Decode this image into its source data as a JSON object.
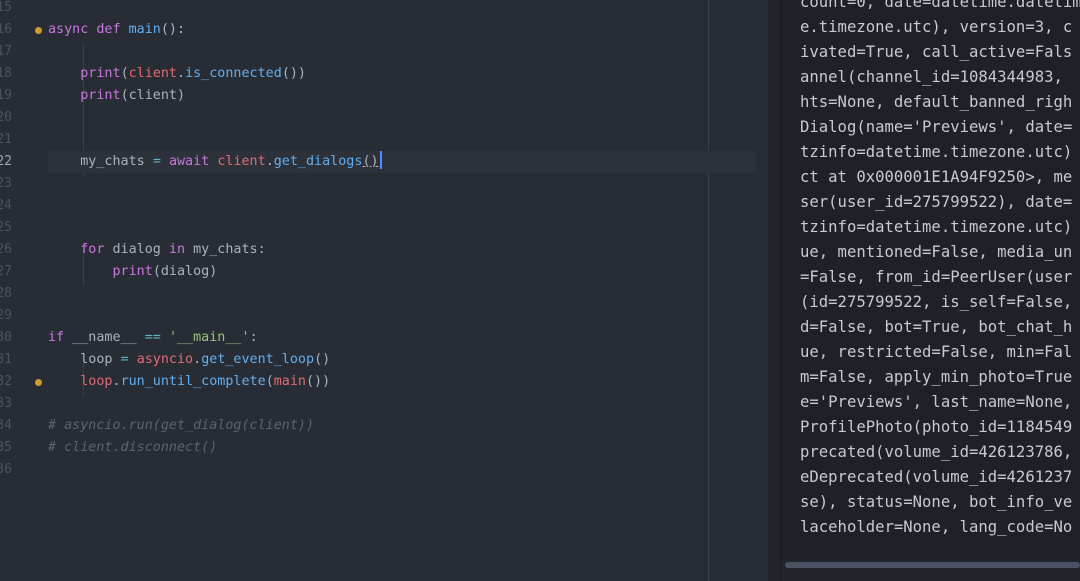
{
  "editor": {
    "lines": [
      {
        "num": "15",
        "tokens": []
      },
      {
        "num": "16",
        "breakpoint": true,
        "tokens": [
          {
            "t": "async def ",
            "c": "kw"
          },
          {
            "t": "main",
            "c": "fn"
          },
          {
            "t": "():",
            "c": "pa"
          }
        ]
      },
      {
        "num": "17",
        "tokens": []
      },
      {
        "num": "18",
        "tokens": [
          {
            "t": "    "
          },
          {
            "t": "print",
            "c": "kw"
          },
          {
            "t": "(",
            "c": "pa"
          },
          {
            "t": "client",
            "c": "vr"
          },
          {
            "t": ".",
            "c": "pa"
          },
          {
            "t": "is_connected",
            "c": "fn"
          },
          {
            "t": "())",
            "c": "pa"
          }
        ]
      },
      {
        "num": "19",
        "tokens": [
          {
            "t": "    "
          },
          {
            "t": "print",
            "c": "kw"
          },
          {
            "t": "(client)",
            "c": "pa"
          }
        ]
      },
      {
        "num": "20",
        "tokens": []
      },
      {
        "num": "21",
        "tokens": []
      },
      {
        "num": "22",
        "current": true,
        "tokens": [
          {
            "t": "    my_chats ",
            "c": "pa"
          },
          {
            "t": "=",
            "c": "op"
          },
          {
            "t": " "
          },
          {
            "t": "await",
            "c": "kw"
          },
          {
            "t": " "
          },
          {
            "t": "client",
            "c": "vr"
          },
          {
            "t": ".",
            "c": "pa"
          },
          {
            "t": "get_dialogs",
            "c": "fn"
          },
          {
            "t": "()",
            "c": "pa",
            "u": true
          }
        ]
      },
      {
        "num": "23",
        "tokens": []
      },
      {
        "num": "24",
        "tokens": []
      },
      {
        "num": "25",
        "tokens": []
      },
      {
        "num": "26",
        "tokens": [
          {
            "t": "    "
          },
          {
            "t": "for",
            "c": "kw"
          },
          {
            "t": " dialog ",
            "c": "pa"
          },
          {
            "t": "in",
            "c": "kw"
          },
          {
            "t": " my_chats:",
            "c": "pa"
          }
        ]
      },
      {
        "num": "27",
        "tokens": [
          {
            "t": "        "
          },
          {
            "t": "print",
            "c": "kw"
          },
          {
            "t": "(dialog)",
            "c": "pa"
          }
        ]
      },
      {
        "num": "28",
        "tokens": []
      },
      {
        "num": "29",
        "tokens": []
      },
      {
        "num": "30",
        "tokens": [
          {
            "t": "if",
            "c": "kw"
          },
          {
            "t": " __name__ ",
            "c": "pa"
          },
          {
            "t": "==",
            "c": "op"
          },
          {
            "t": " "
          },
          {
            "t": "'__main__'",
            "c": "st"
          },
          {
            "t": ":",
            "c": "pa"
          }
        ]
      },
      {
        "num": "31",
        "tokens": [
          {
            "t": "    loop ",
            "c": "pa"
          },
          {
            "t": "=",
            "c": "op"
          },
          {
            "t": " "
          },
          {
            "t": "asyncio",
            "c": "vr"
          },
          {
            "t": ".",
            "c": "pa"
          },
          {
            "t": "get_event_loop",
            "c": "fn"
          },
          {
            "t": "()",
            "c": "pa"
          }
        ]
      },
      {
        "num": "32",
        "breakpoint": true,
        "tokens": [
          {
            "t": "    "
          },
          {
            "t": "loop",
            "c": "vr"
          },
          {
            "t": ".",
            "c": "pa"
          },
          {
            "t": "run_until_complete",
            "c": "fn"
          },
          {
            "t": "(",
            "c": "pa"
          },
          {
            "t": "main",
            "c": "vr"
          },
          {
            "t": "())",
            "c": "pa"
          }
        ]
      },
      {
        "num": "33",
        "tokens": []
      },
      {
        "num": "34",
        "tokens": [
          {
            "t": "# asyncio.run(get_dialog(client))",
            "c": "cm"
          }
        ]
      },
      {
        "num": "35",
        "tokens": [
          {
            "t": "# client.disconnect()",
            "c": "cm"
          }
        ]
      },
      {
        "num": "36",
        "tokens": []
      }
    ]
  },
  "output": {
    "lines": [
      "count=0, date=datetime.datetim",
      "e.timezone.utc), version=3, c",
      "ivated=True, call_active=Fals",
      "annel(channel_id=1084344983,",
      "hts=None, default_banned_righ",
      "Dialog(name='Previews', date=",
      "tzinfo=datetime.timezone.utc)",
      "ct at 0x000001E1A94F9250>, me",
      "ser(user_id=275799522), date=",
      "tzinfo=datetime.timezone.utc)",
      "ue, mentioned=False, media_un",
      "=False, from_id=PeerUser(user",
      "(id=275799522, is_self=False,",
      "d=False, bot=True, bot_chat_h",
      "ue, restricted=False, min=Fal",
      "m=False, apply_min_photo=True",
      "e='Previews', last_name=None,",
      "ProfilePhoto(photo_id=1184549",
      "precated(volume_id=426123786,",
      "eDeprecated(volume_id=4261237",
      "se), status=None, bot_info_ve",
      "laceholder=None, lang_code=No"
    ]
  }
}
